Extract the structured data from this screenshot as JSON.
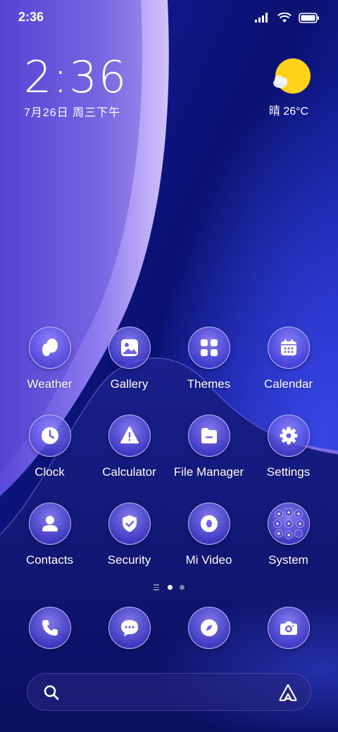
{
  "status_bar": {
    "time": "2:36",
    "icons": [
      "signal-icon",
      "wifi-icon",
      "battery-icon"
    ]
  },
  "clock_widget": {
    "time": "2:36",
    "date": "7月26日 周三下午"
  },
  "weather_widget": {
    "icon": "sunny-cloud-icon",
    "text": "晴 26°C"
  },
  "apps": [
    {
      "label": "Weather",
      "icon": "weather-icon"
    },
    {
      "label": "Gallery",
      "icon": "gallery-icon"
    },
    {
      "label": "Themes",
      "icon": "themes-icon"
    },
    {
      "label": "Calendar",
      "icon": "calendar-icon"
    },
    {
      "label": "Clock",
      "icon": "clock-icon"
    },
    {
      "label": "Calculator",
      "icon": "calculator-icon"
    },
    {
      "label": "File Manager",
      "icon": "file-manager-icon"
    },
    {
      "label": "Settings",
      "icon": "settings-icon"
    },
    {
      "label": "Contacts",
      "icon": "contacts-icon"
    },
    {
      "label": "Security",
      "icon": "security-icon"
    },
    {
      "label": "Mi Video",
      "icon": "mi-video-icon"
    },
    {
      "label": "System",
      "icon": "system-folder-icon"
    }
  ],
  "page_indicator": {
    "pages": 2,
    "active": 1
  },
  "dock": [
    {
      "icon": "phone-icon"
    },
    {
      "icon": "messages-icon"
    },
    {
      "icon": "browser-icon"
    },
    {
      "icon": "camera-icon"
    }
  ],
  "search_bar": {
    "icons": [
      "search-icon",
      "assistant-icon"
    ]
  },
  "colors": {
    "wallpaper_dark": "#0b1170",
    "wallpaper_mid": "#2a38d8",
    "wallpaper_light": "#b7a8f0",
    "sun": "#ffd21a",
    "icon_fill": "#7a6ff0"
  }
}
